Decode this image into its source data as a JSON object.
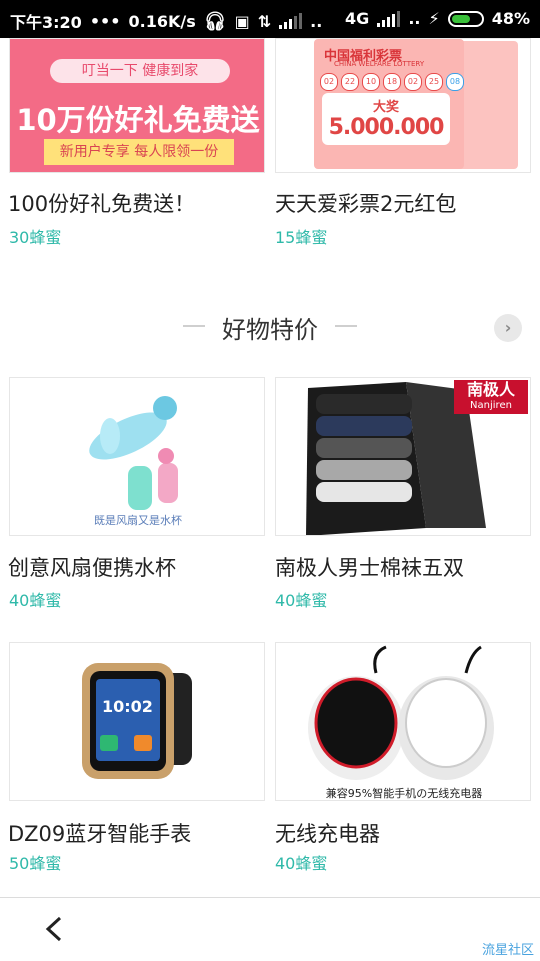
{
  "status_bar": {
    "time": "下午3:20",
    "speed": "0.16K/s",
    "network": "4G",
    "battery": "48%"
  },
  "colors": {
    "price": "#2fb9a9",
    "battery_fill": "#3ac03a"
  },
  "top_row": [
    {
      "title": "100份好礼免费送！",
      "price": "30蜂蜜",
      "image": {
        "band": "叮当一下 健康到家",
        "headline": "10万份好礼免费送",
        "footer": "新用户专享 每人限领一份"
      }
    },
    {
      "title": "天天爱彩票2元红包",
      "price": "15蜂蜜",
      "image": {
        "logo": "中国福利彩票",
        "logo_en": "CHINA WELFARE LOTTERY",
        "prize_label": "大奖",
        "prize_value": "5.000.000",
        "balls": [
          "02",
          "22",
          "10",
          "18",
          "02",
          "25",
          "08"
        ]
      }
    }
  ],
  "section": {
    "title": "好物特价"
  },
  "products": [
    {
      "title": "创意风扇便携水杯",
      "price": "40蜂蜜",
      "caption": "既是风扇又是水杯",
      "icon": "fan-bottle-image"
    },
    {
      "title": "南极人男士棉袜五双",
      "price": "40蜂蜜",
      "brand": "南极人",
      "brand_en": "Nanjiren",
      "icon": "socks-box-image"
    },
    {
      "title": "DZ09蓝牙智能手表",
      "price": "50蜂蜜",
      "watch_time": "10:02",
      "icon": "smartwatch-image"
    },
    {
      "title": "无线充电器",
      "price": "40蜂蜜",
      "caption": "兼容95%智能手机の无线充电器",
      "icon": "wireless-charger-image"
    }
  ],
  "nav": {
    "back_icon": "back-chevron-icon"
  },
  "watermark": "流星社区"
}
